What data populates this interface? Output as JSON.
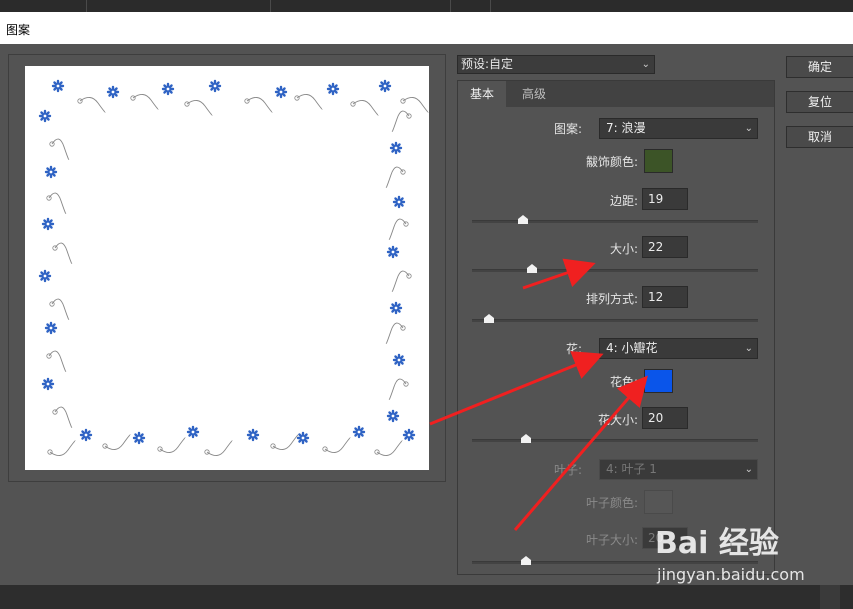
{
  "dialog": {
    "title": "图案"
  },
  "preset": {
    "label": "预设:",
    "value": "自定"
  },
  "buttons": {
    "ok": "确定",
    "reset": "复位",
    "cancel": "取消"
  },
  "tabs": [
    {
      "label": "基本",
      "active": true
    },
    {
      "label": "高级",
      "active": false
    }
  ],
  "fields": {
    "pattern": {
      "label": "图案:",
      "value": "7: 浪漫"
    },
    "decor_color": {
      "label": "黻饰颜色:",
      "color": "#3c5427"
    },
    "margin": {
      "label": "边距:",
      "value": "19",
      "slider": 0.18
    },
    "size": {
      "label": "大小:",
      "value": "22",
      "slider": 0.21
    },
    "arrangement": {
      "label": "排列方式:",
      "value": "12",
      "slider": 0.06
    },
    "flower": {
      "label": "花:",
      "value": "4: 小瓣花"
    },
    "flower_color": {
      "label": "花色:",
      "color": "#0a55ea"
    },
    "flower_size": {
      "label": "花大小:",
      "value": "20",
      "slider": 0.19
    },
    "leaf": {
      "label": "叶子:",
      "value": "4: 叶子 1"
    },
    "leaf_color": {
      "label": "叶子颜色:"
    },
    "leaf_size": {
      "label": "叶子大小:",
      "value": "20",
      "slider": 0.19
    }
  },
  "watermark": {
    "logo": "Bai 经验",
    "url": "jingyan.baidu.com"
  },
  "colors": {
    "flower": "#2f63c4",
    "vine": "#888888",
    "arrow": "#f02020"
  },
  "icons": [
    "chevron-down-icon",
    "slider-thumb-icon",
    "flower-icon",
    "arrow-annotation-icon"
  ]
}
